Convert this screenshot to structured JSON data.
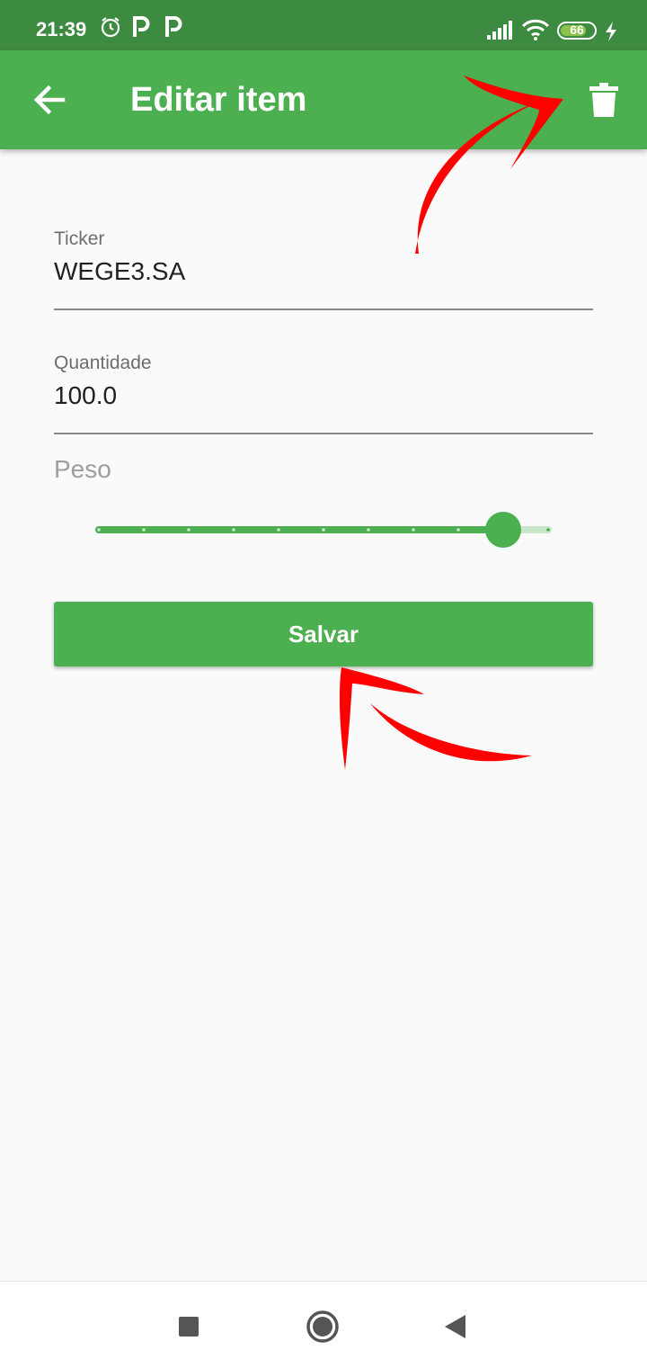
{
  "status_bar": {
    "time": "21:39",
    "battery": "66",
    "icons": [
      "alarm-icon",
      "parking-icon",
      "parking-icon",
      "signal-icon",
      "wifi-icon",
      "battery-icon",
      "charging-icon"
    ]
  },
  "app_bar": {
    "title": "Editar item",
    "back_icon": "arrow-left-icon",
    "delete_icon": "trash-icon",
    "color": "#4caf50"
  },
  "form": {
    "ticker": {
      "label": "Ticker",
      "value": "WEGE3.SA"
    },
    "quantidade": {
      "label": "Quantidade",
      "value": "100.0"
    },
    "peso": {
      "label": "Peso",
      "value": 0.9,
      "divisions": 10
    },
    "save_label": "Salvar"
  },
  "nav_bar": {
    "icons": [
      "recents-square-icon",
      "home-circle-icon",
      "back-triangle-icon"
    ]
  },
  "annotations": {
    "arrow_color": "#ff0000",
    "targets": [
      "delete-button",
      "save-button"
    ]
  }
}
